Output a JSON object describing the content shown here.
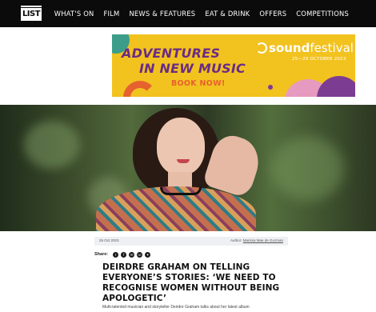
{
  "header": {
    "logo_text": "LIST",
    "nav_items": [
      "WHAT'S ON",
      "FILM",
      "NEWS & FEATURES",
      "EAT & DRINK",
      "OFFERS",
      "COMPETITIONS"
    ]
  },
  "ad": {
    "headline_line1": "ADVENTURES",
    "headline_line2": "IN NEW MUSIC",
    "cta": "BOOK NOW!",
    "brand_bold": "sound",
    "brand_rest": "festival",
    "dates": "25—29 OCTOBER 2023",
    "colors": {
      "background": "#f2c21f",
      "headline": "#6a2c86",
      "cta": "#e7612e"
    }
  },
  "hero": {
    "image": "portrait-photo"
  },
  "article": {
    "date": "26 Oct 2023",
    "author_label": "Author:",
    "author_name": "Marissa Mae de Guzman",
    "share_label": "Share:",
    "share_icons": [
      "twitter-icon",
      "facebook-icon",
      "email-icon",
      "whatsapp-icon",
      "messenger-icon"
    ],
    "title": "DEIRDRE GRAHAM ON TELLING EVERYONE’S STORIES: ‘WE NEED TO RECOGNISE WOMEN WITHOUT BEING APOLOGETIC’",
    "teaser": "Multi-talented musician and storyteller Deirdre Graham talks about her latest album"
  }
}
